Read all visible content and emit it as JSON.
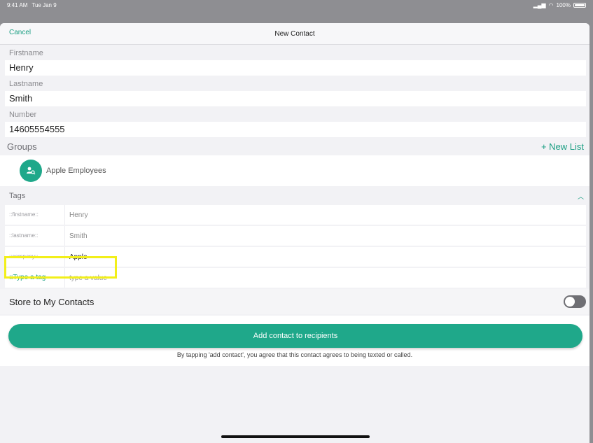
{
  "status_bar": {
    "time": "9:41 AM",
    "date": "Tue Jan 9",
    "battery_text": "100%"
  },
  "nav": {
    "cancel_label": "Cancel",
    "title": "New Contact"
  },
  "fields": {
    "firstname_label": "Firstname",
    "firstname_value": "Henry",
    "lastname_label": "Lastname",
    "lastname_value": "Smith",
    "number_label": "Number",
    "number_value": "14605554555"
  },
  "groups": {
    "title": "Groups",
    "new_list_label": "+ New List",
    "items": [
      {
        "name": "Apple Employees",
        "icon": "group-search-icon"
      }
    ]
  },
  "tags": {
    "title": "Tags",
    "rows": [
      {
        "key": "::firstname::",
        "value": "Henry"
      },
      {
        "key": "::lastname::",
        "value": "Smith"
      },
      {
        "key": "::company::",
        "value": "Apple"
      }
    ],
    "new_key_placeholder": "::Type a tag",
    "new_value_placeholder": "type a value"
  },
  "store": {
    "label": "Store to My Contacts",
    "enabled": false
  },
  "action": {
    "button_label": "Add contact to recipients",
    "disclaimer": "By tapping 'add contact', you agree that this contact agrees to being texted or called."
  },
  "colors": {
    "accent": "#1fa88a",
    "highlight": "#f2ef1a"
  }
}
